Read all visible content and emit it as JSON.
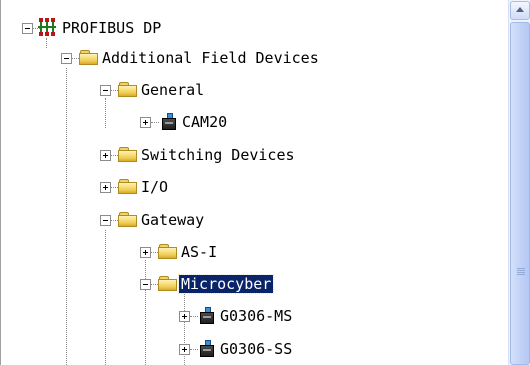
{
  "tree": {
    "nodes": [
      {
        "label": "PROFIBUS DP",
        "icon": "network-icon",
        "state": "expanded"
      },
      {
        "label": "Additional Field Devices",
        "icon": "folder-icon",
        "state": "expanded"
      },
      {
        "label": "General",
        "icon": "folder-icon",
        "state": "expanded"
      },
      {
        "label": "CAM20",
        "icon": "device-icon",
        "state": "collapsed"
      },
      {
        "label": "Switching Devices",
        "icon": "folder-icon",
        "state": "collapsed"
      },
      {
        "label": "I/O",
        "icon": "folder-icon",
        "state": "collapsed"
      },
      {
        "label": "Gateway",
        "icon": "folder-icon",
        "state": "expanded"
      },
      {
        "label": "AS-I",
        "icon": "folder-icon",
        "state": "collapsed"
      },
      {
        "label": "Microcyber",
        "icon": "folder-icon",
        "state": "expanded",
        "selected": true
      },
      {
        "label": "G0306-MS",
        "icon": "device-icon",
        "state": "collapsed"
      },
      {
        "label": "G0306-SS",
        "icon": "device-icon",
        "state": "collapsed"
      }
    ]
  },
  "colors": {
    "selection_background": "#0a246a",
    "selection_text": "#ffffff",
    "scrollbar_track": "#eef2fb"
  }
}
